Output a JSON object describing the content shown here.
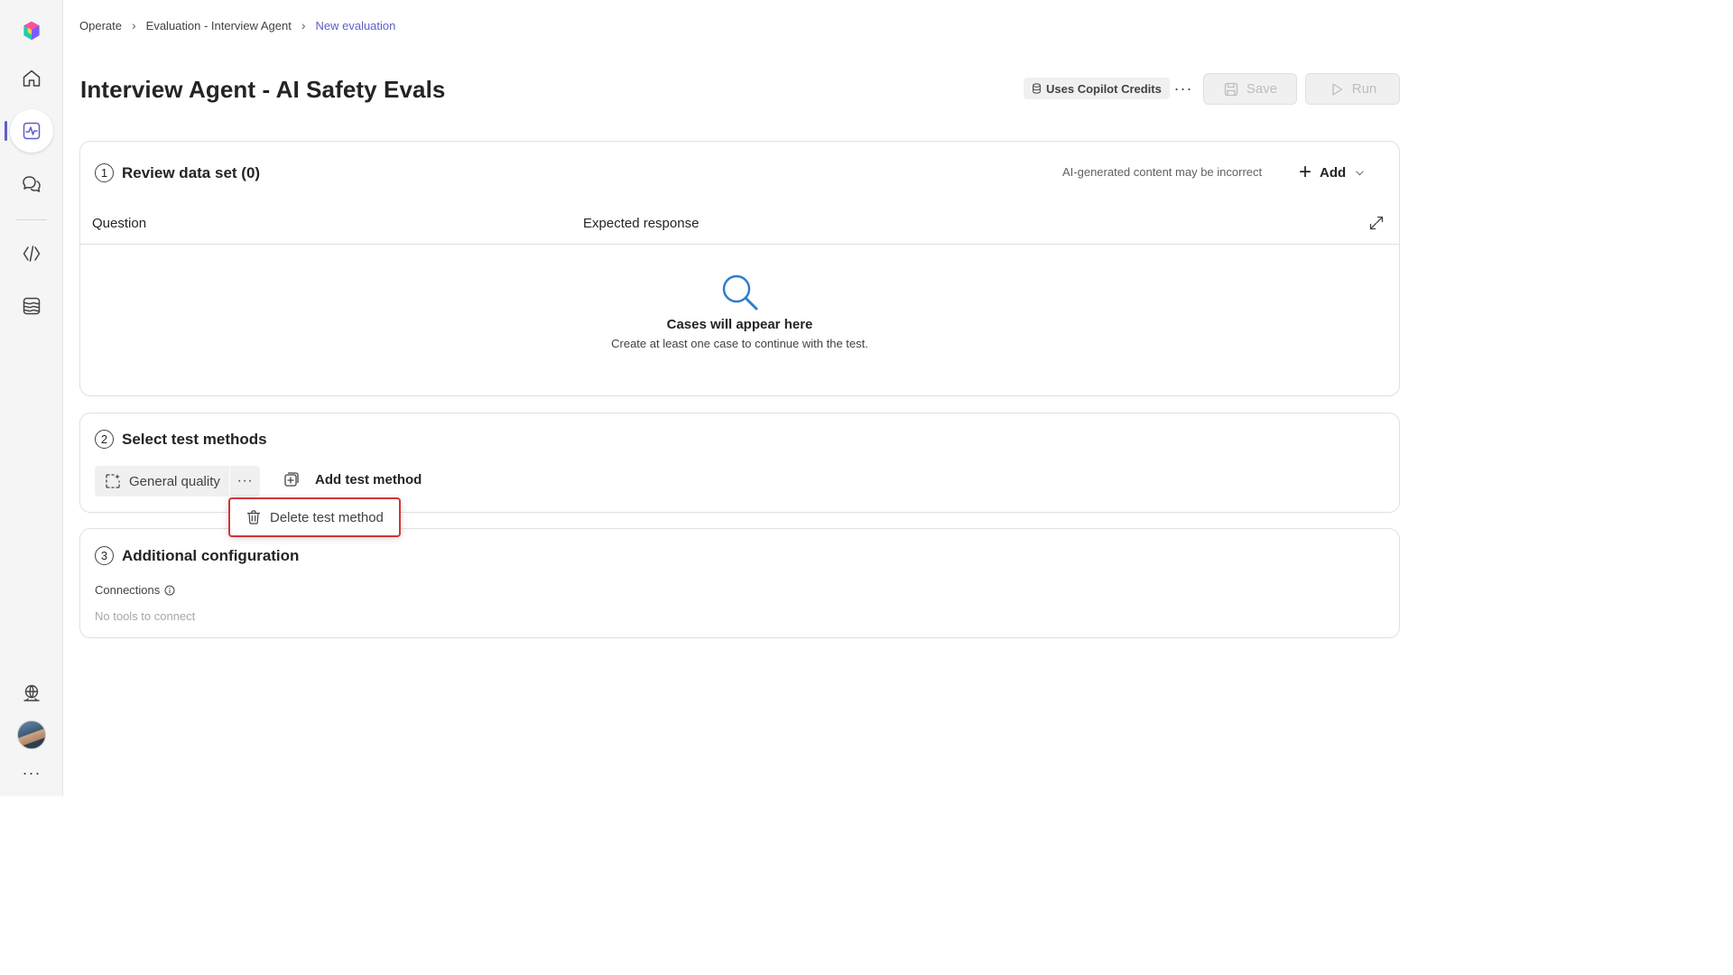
{
  "rail": {
    "items": [
      {
        "name": "home",
        "icon": "home-icon"
      },
      {
        "name": "monitor",
        "icon": "pulse-icon",
        "active": true
      },
      {
        "name": "chat",
        "icon": "chat-icon"
      },
      {
        "name": "code",
        "icon": "code-icon"
      },
      {
        "name": "data",
        "icon": "waves-icon"
      }
    ],
    "more_label": "···"
  },
  "breadcrumb": {
    "items": [
      "Operate",
      "Evaluation - Interview Agent"
    ],
    "current": "New evaluation"
  },
  "header": {
    "title": "Interview Agent - AI Safety Evals",
    "credits_label": "Uses Copilot Credits",
    "more_label": "···",
    "save_label": "Save",
    "run_label": "Run"
  },
  "review": {
    "step": "1",
    "title": "Review data set (0)",
    "ai_note": "AI-generated content may be incorrect",
    "add_label": "Add",
    "columns": [
      "Question",
      "Expected response"
    ],
    "empty_title": "Cases will appear here",
    "empty_subtitle": "Create at least one case to continue with the test."
  },
  "methods": {
    "step": "2",
    "title": "Select test methods",
    "chip_label": "General quality",
    "chip_more": "···",
    "add_method_label": "Add test method",
    "menu_item": "Delete test method"
  },
  "config": {
    "step": "3",
    "title": "Additional configuration",
    "connections_label": "Connections",
    "connections_empty": "No tools to connect"
  },
  "colors": {
    "accent": "#5b5fc7",
    "highlight_border": "#d13438"
  }
}
